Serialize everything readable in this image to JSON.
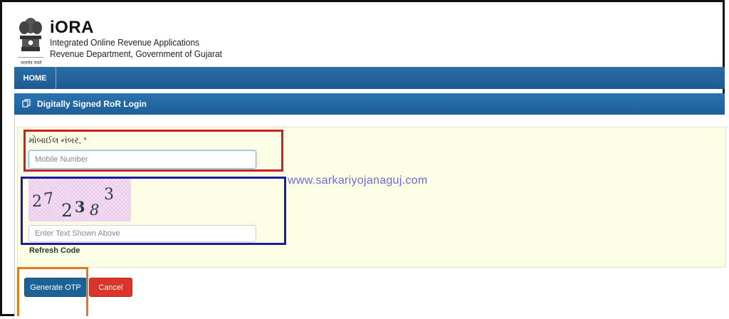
{
  "header": {
    "emblem_caption": "सत्यमेव जयते",
    "title": "iORA",
    "subtitle_line1": "Integrated Online Revenue Applications",
    "subtitle_line2": "Revenue Department, Government of Gujarat"
  },
  "nav": {
    "home_label": "HOME"
  },
  "panel": {
    "title": "Digitally Signed RoR Login",
    "title_icon": "document-copy-icon"
  },
  "form": {
    "mobile_label": "મોબાઈલ નંબર,",
    "required_marker": "*",
    "mobile_placeholder": "Mobile Number",
    "mobile_value": "",
    "captcha_text": "27 238 3",
    "captcha_placeholder": "Enter Text Shown Above",
    "captcha_value": "",
    "refresh_label": "Refresh Code"
  },
  "watermark": "www.sarkariyojanaguj.com",
  "buttons": {
    "generate_otp": "Generate OTP",
    "cancel": "Cancel"
  },
  "colors": {
    "nav_blue": "#1d5a92",
    "form_background": "#fdfde6",
    "otp_button": "#1d6296",
    "cancel_button": "#d9342a",
    "annotation_red": "#cc1f1f",
    "annotation_blue": "#1b1ba0",
    "annotation_orange": "#e07a1a"
  }
}
